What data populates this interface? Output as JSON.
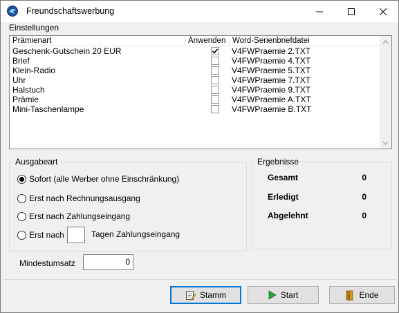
{
  "window": {
    "title": "Freundschaftswerbung"
  },
  "settings": {
    "label": "Einstellungen",
    "columns": [
      "Prämienart",
      "Anwenden",
      "Word-Serienbriefdatei"
    ],
    "rows": [
      {
        "name": "Geschenk-Gutschein 20 EUR",
        "apply": true,
        "file": "V4FWPraemie 2.TXT"
      },
      {
        "name": "Brief",
        "apply": false,
        "file": "V4FWPraemie 4.TXT"
      },
      {
        "name": "Klein-Radio",
        "apply": false,
        "file": "V4FWPraemie 5.TXT"
      },
      {
        "name": "Uhr",
        "apply": false,
        "file": "V4FWPraemie 7.TXT"
      },
      {
        "name": "Halstuch",
        "apply": false,
        "file": "V4FWPraemie 9.TXT"
      },
      {
        "name": "Prämie",
        "apply": false,
        "file": "V4FWPraemie A.TXT"
      },
      {
        "name": "Mini-Taschenlampe",
        "apply": false,
        "file": "V4FWPraemie B.TXT"
      }
    ]
  },
  "output": {
    "legend": "Ausgabeart",
    "options": [
      {
        "label": "Sofort (alle Werber ohne Einschränkung)",
        "checked": true
      },
      {
        "label": "Erst nach Rechnungsausgang",
        "checked": false
      },
      {
        "label": "Erst nach Zahlungseingang",
        "checked": false
      },
      {
        "label": "Erst nach",
        "checked": false
      }
    ],
    "days_value": "",
    "days_suffix": "Tagen Zahlungseingang"
  },
  "results": {
    "legend": "Ergebnisse",
    "items": [
      {
        "label": "Gesamt",
        "value": "0"
      },
      {
        "label": "Erledigt",
        "value": "0"
      },
      {
        "label": "Abgelehnt",
        "value": "0"
      }
    ]
  },
  "min_revenue": {
    "label": "Mindestumsatz",
    "value": "0"
  },
  "buttons": {
    "stamm": "Stamm",
    "start": "Start",
    "ende": "Ende"
  },
  "colors": {
    "accent": "#0078d7",
    "start_icon": "#2ea043",
    "ende_icon": "#d99a1e"
  }
}
